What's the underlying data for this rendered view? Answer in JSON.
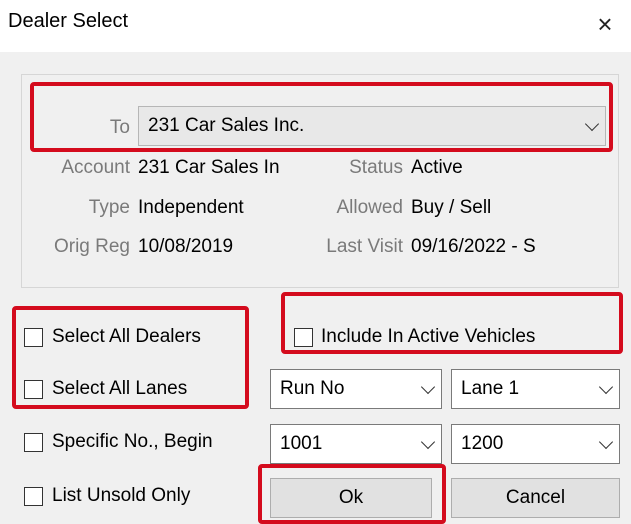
{
  "window": {
    "title": "Dealer Select",
    "close_icon": "×"
  },
  "to_field": {
    "label": "To",
    "value": "231 Car Sales Inc."
  },
  "info": {
    "account_label": "Account",
    "account_value": "231 Car Sales In",
    "status_label": "Status",
    "status_value": "Active",
    "type_label": "Type",
    "type_value": "Independent",
    "allowed_label": "Allowed",
    "allowed_value": "Buy / Sell",
    "orig_reg_label": "Orig Reg",
    "orig_reg_value": "10/08/2019",
    "last_visit_label": "Last Visit",
    "last_visit_value": "09/16/2022 - S"
  },
  "options": {
    "select_all_dealers": "Select All Dealers",
    "select_all_lanes": "Select All Lanes",
    "specific_no_begin": "Specific No., Begin",
    "list_unsold_only": "List Unsold Only",
    "include_active_vehicles": "Include In Active Vehicles"
  },
  "dropdowns": {
    "run_no": "Run No",
    "lane": "Lane 1",
    "begin": "1001",
    "end": "1200"
  },
  "buttons": {
    "ok": "Ok",
    "cancel": "Cancel"
  },
  "colors": {
    "highlight": "#d40b1d",
    "panel_bg": "#f0f0f0"
  }
}
